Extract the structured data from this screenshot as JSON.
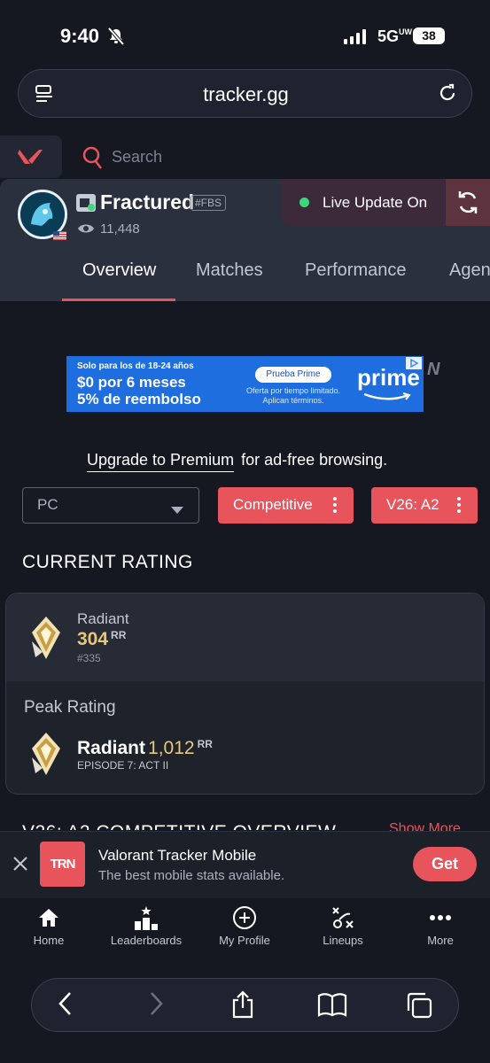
{
  "status_bar": {
    "time": "9:40",
    "network": "5G",
    "network_suffix": "UW",
    "battery": "38"
  },
  "browser": {
    "url": "tracker.gg"
  },
  "site_header": {
    "search_placeholder": "Search"
  },
  "profile": {
    "name": "Fractured",
    "tag": "#FBS",
    "views": "11,448",
    "live_update_label": "Live Update On",
    "tabs": [
      {
        "label": "Overview",
        "active": true
      },
      {
        "label": "Matches",
        "active": false
      },
      {
        "label": "Performance",
        "active": false
      },
      {
        "label": "Agen",
        "active": false
      }
    ]
  },
  "ad": {
    "line1": "Solo para los de 18-24 años",
    "line2": "$0 por 6 meses",
    "line3": "5% de reembolso",
    "button": "Prueba Prime",
    "small1": "Oferta por tiempo limitado.",
    "small2": "Aplican términos.",
    "brand": "prime"
  },
  "upgrade": {
    "link": "Upgrade to Premium",
    "rest": "for ad-free browsing."
  },
  "filters": {
    "platform": "PC",
    "mode": "Competitive",
    "season": "V26: A2"
  },
  "current_rating": {
    "section_title": "CURRENT RATING",
    "rank": "Radiant",
    "rr": "304",
    "unit": "RR",
    "position": "#335",
    "peak_label": "Peak Rating",
    "peak_rank": "Radiant",
    "peak_rr": "1,012",
    "peak_unit": "RR",
    "peak_episode": "EPISODE 7: ACT II"
  },
  "overview_title_partial": "V26: A2 COMPETITIVE OVERVIEW",
  "show_more": "Show More",
  "app_banner": {
    "logo_text": "TRN",
    "title": "Valorant Tracker Mobile",
    "subtitle": "The best mobile stats available.",
    "cta": "Get"
  },
  "bottom_nav": [
    {
      "label": "Home",
      "icon": "home-icon"
    },
    {
      "label": "Leaderboards",
      "icon": "leaderboard-icon"
    },
    {
      "label": "My Profile",
      "icon": "plus-circle-icon"
    },
    {
      "label": "Lineups",
      "icon": "lineups-icon"
    },
    {
      "label": "More",
      "icon": "more-icon"
    }
  ],
  "colors": {
    "accent": "#e8545c",
    "gold": "#e7c77b",
    "background": "#151820",
    "live_dot": "#3ed67a"
  }
}
